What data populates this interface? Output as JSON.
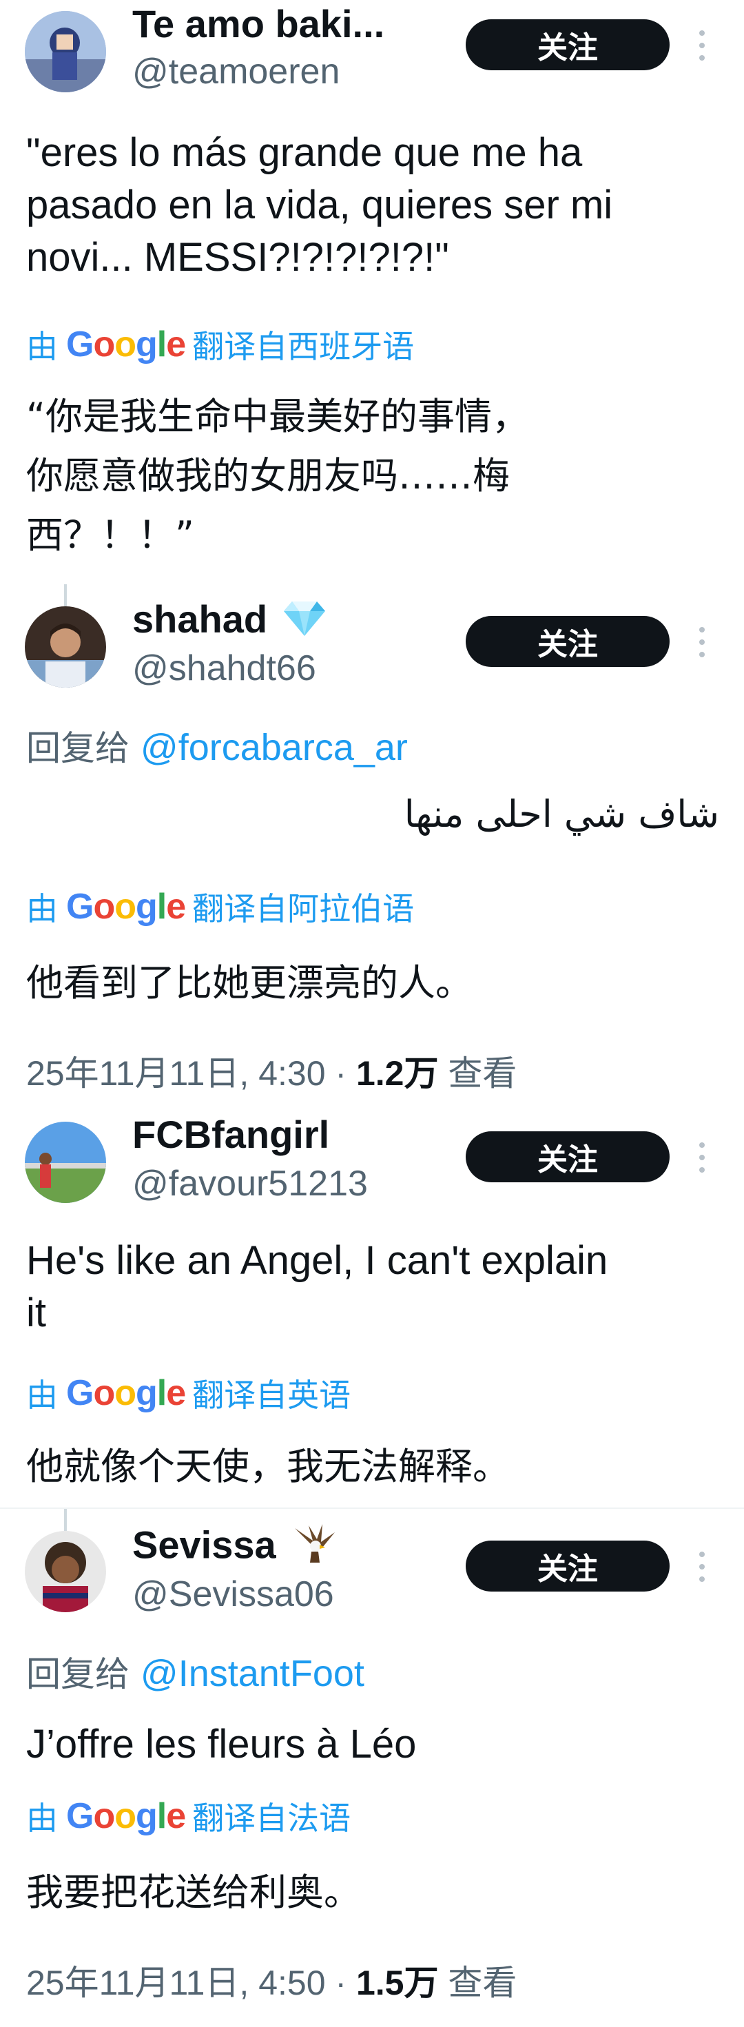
{
  "follow_label": "关注",
  "translated_by": "由",
  "google_logo": "Google",
  "posts": [
    {
      "name": "Te amo baki...",
      "handle": "@teamoeren",
      "text_lines": [
        "\"eres lo más grande que me ha",
        "pasado en la vida, quieres ser mi",
        "novi... MESSI?!?!?!?!?!\""
      ],
      "translated_from": "翻译自西班牙语",
      "translation_lines": [
        "“你是我生命中最美好的事情，",
        "你愿意做我的女朋友吗……梅",
        "西？！！”"
      ]
    },
    {
      "name": "shahad",
      "name_badge_icon": "gem-icon",
      "handle": "@shahdt66",
      "reply_prefix": "回复给",
      "reply_to": "@forcabarca_ar",
      "text": "شاف شي احلى منها",
      "translated_from": "翻译自阿拉伯语",
      "translation": "他看到了比她更漂亮的人。",
      "timestamp": "25年11月11日, 4:30 · ",
      "views": "1.2万",
      "views_label": " 查看"
    },
    {
      "name": "FCBfangirl",
      "handle": "@favour51213",
      "text_lines": [
        "He's like an Angel, I can't explain",
        "it"
      ],
      "translated_from": "翻译自英语",
      "translation": "他就像个天使，我无法解释。"
    },
    {
      "name": "Sevissa",
      "name_badge_icon": "eagle-icon",
      "handle": "@Sevissa06",
      "reply_prefix": "回复给",
      "reply_to": "@InstantFoot",
      "text": "J’offre les fleurs à Léo",
      "translated_from": "翻译自法语",
      "translation": "我要把花送给利奥。",
      "timestamp": "25年11月11日, 4:50 · ",
      "views": "1.5万",
      "views_label": " 查看"
    }
  ]
}
